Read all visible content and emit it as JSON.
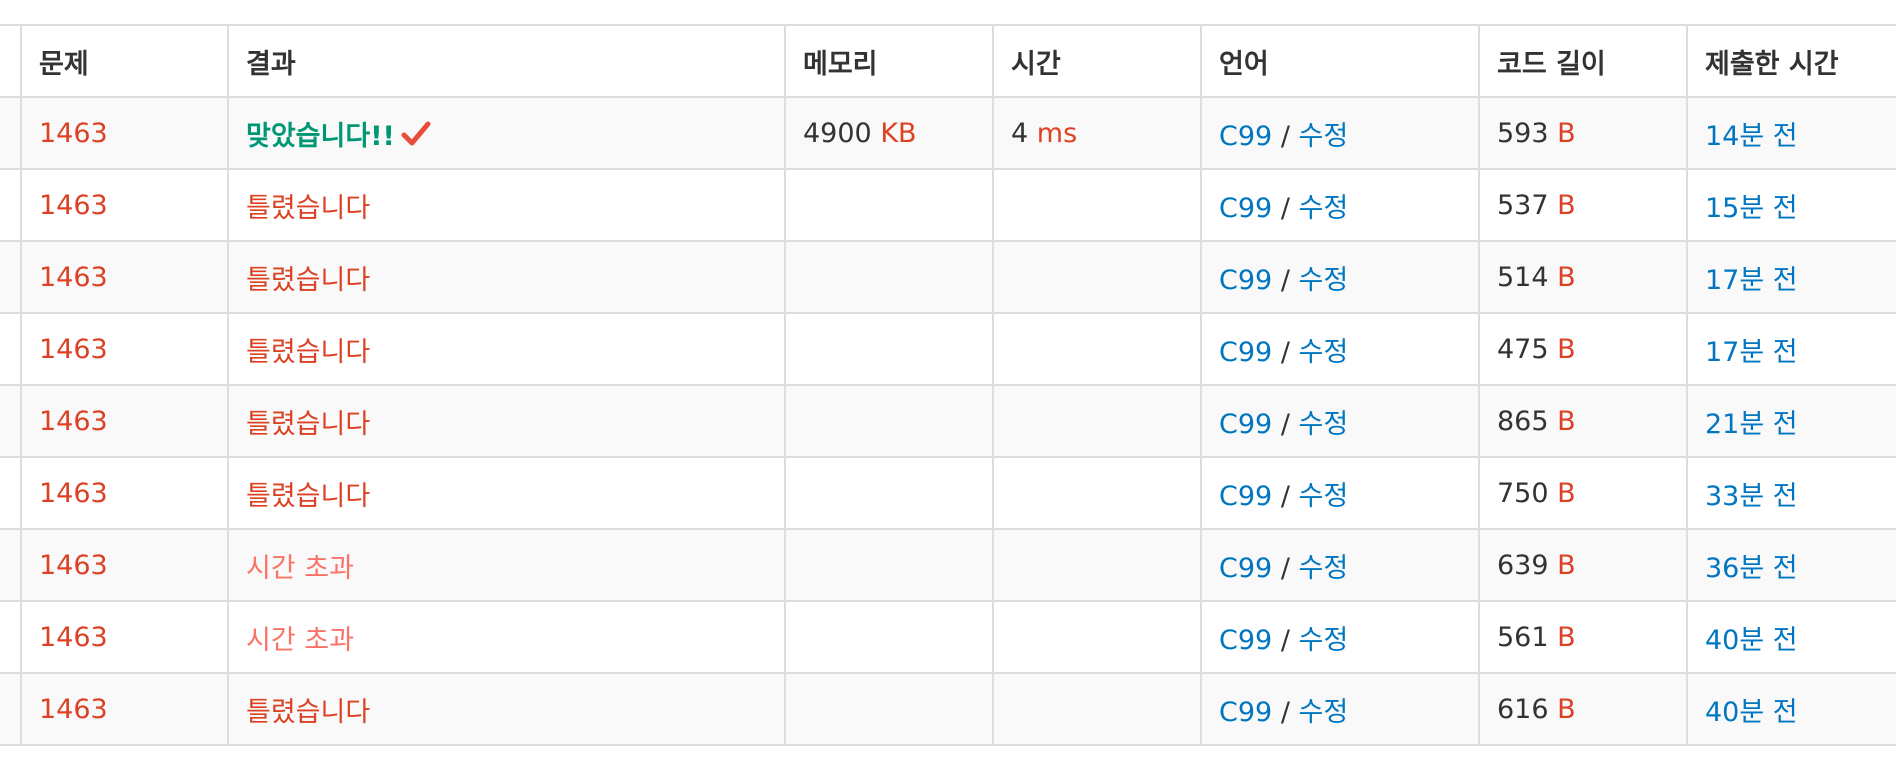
{
  "headers": [
    "문제",
    "결과",
    "메모리",
    "시간",
    "언어",
    "코드 길이",
    "제출한 시간"
  ],
  "memory_unit": "KB",
  "time_unit": "ms",
  "length_unit": "B",
  "separator": "/",
  "colors": {
    "problem_link": "#dd4124",
    "accepted": "#009874",
    "wrong": "#dd4124",
    "time_limit": "#fa7268",
    "link_blue": "#0076c0",
    "check_mark": "#e74c3c"
  },
  "rows": [
    {
      "problem": "1463",
      "result": "맞았습니다!!",
      "result_type": "ac",
      "memory": "4900",
      "time": "4",
      "language": "C99",
      "edit": "수정",
      "length": "593",
      "submitted": "14분 전"
    },
    {
      "problem": "1463",
      "result": "틀렸습니다",
      "result_type": "wa",
      "memory": "",
      "time": "",
      "language": "C99",
      "edit": "수정",
      "length": "537",
      "submitted": "15분 전"
    },
    {
      "problem": "1463",
      "result": "틀렸습니다",
      "result_type": "wa",
      "memory": "",
      "time": "",
      "language": "C99",
      "edit": "수정",
      "length": "514",
      "submitted": "17분 전"
    },
    {
      "problem": "1463",
      "result": "틀렸습니다",
      "result_type": "wa",
      "memory": "",
      "time": "",
      "language": "C99",
      "edit": "수정",
      "length": "475",
      "submitted": "17분 전"
    },
    {
      "problem": "1463",
      "result": "틀렸습니다",
      "result_type": "wa",
      "memory": "",
      "time": "",
      "language": "C99",
      "edit": "수정",
      "length": "865",
      "submitted": "21분 전"
    },
    {
      "problem": "1463",
      "result": "틀렸습니다",
      "result_type": "wa",
      "memory": "",
      "time": "",
      "language": "C99",
      "edit": "수정",
      "length": "750",
      "submitted": "33분 전"
    },
    {
      "problem": "1463",
      "result": "시간 초과",
      "result_type": "tle",
      "memory": "",
      "time": "",
      "language": "C99",
      "edit": "수정",
      "length": "639",
      "submitted": "36분 전"
    },
    {
      "problem": "1463",
      "result": "시간 초과",
      "result_type": "tle",
      "memory": "",
      "time": "",
      "language": "C99",
      "edit": "수정",
      "length": "561",
      "submitted": "40분 전"
    },
    {
      "problem": "1463",
      "result": "틀렸습니다",
      "result_type": "wa",
      "memory": "",
      "time": "",
      "language": "C99",
      "edit": "수정",
      "length": "616",
      "submitted": "40분 전"
    }
  ]
}
